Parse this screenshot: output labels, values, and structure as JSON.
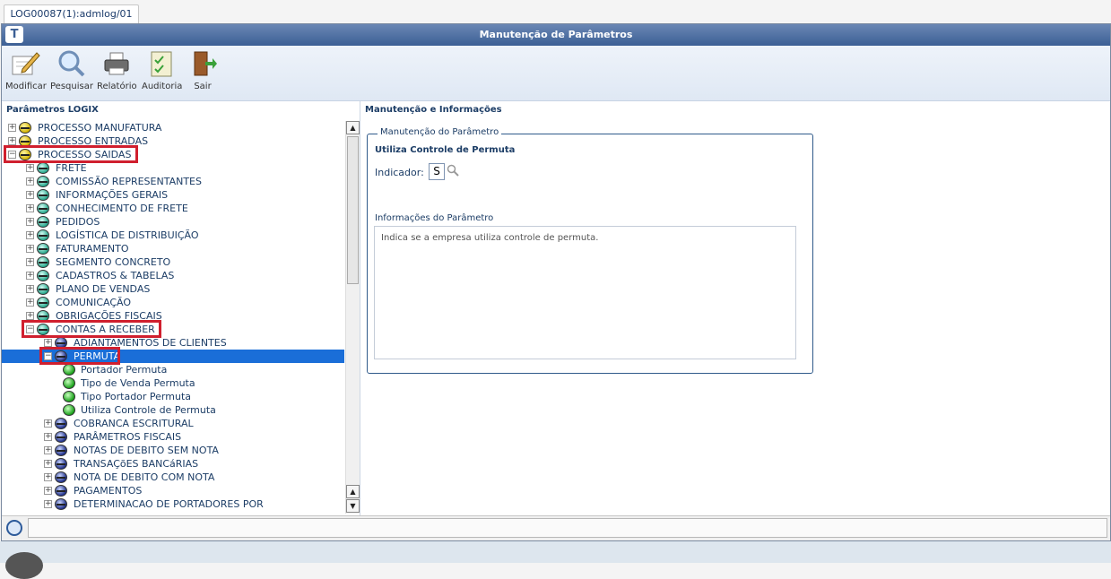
{
  "tab": {
    "label": "LOG00087(1):admlog/01"
  },
  "window": {
    "title": "Manutenção de Parâmetros"
  },
  "toolbar": {
    "modificar": "Modificar",
    "pesquisar": "Pesquisar",
    "relatorio": "Relatório",
    "auditoria": "Auditoria",
    "sair": "Sair"
  },
  "left": {
    "title": "Parâmetros LOGIX",
    "tree": [
      {
        "label": "PROCESSO MANUFATURA",
        "level": 0,
        "icon": "yellow-node-icon",
        "expander": "+"
      },
      {
        "label": "PROCESSO ENTRADAS",
        "level": 0,
        "icon": "yellow-node-icon",
        "expander": "+"
      },
      {
        "label": "PROCESSO SAIDAS",
        "level": 0,
        "icon": "yellow-node-icon",
        "expander": "-"
      },
      {
        "label": "FRETE",
        "level": 1,
        "icon": "teal-node-icon",
        "expander": "+"
      },
      {
        "label": "COMISSÃO REPRESENTANTES",
        "level": 1,
        "icon": "teal-node-icon",
        "expander": "+"
      },
      {
        "label": "INFORMAÇÕES GERAIS",
        "level": 1,
        "icon": "teal-node-icon",
        "expander": "+"
      },
      {
        "label": "CONHECIMENTO DE FRETE",
        "level": 1,
        "icon": "teal-node-icon",
        "expander": "+"
      },
      {
        "label": "PEDIDOS",
        "level": 1,
        "icon": "teal-node-icon",
        "expander": "+"
      },
      {
        "label": "LOGÍSTICA DE DISTRIBUIÇÃO",
        "level": 1,
        "icon": "teal-node-icon",
        "expander": "+"
      },
      {
        "label": "FATURAMENTO",
        "level": 1,
        "icon": "teal-node-icon",
        "expander": "+"
      },
      {
        "label": "SEGMENTO CONCRETO",
        "level": 1,
        "icon": "teal-node-icon",
        "expander": "+"
      },
      {
        "label": "CADASTROS & TABELAS",
        "level": 1,
        "icon": "teal-node-icon",
        "expander": "+"
      },
      {
        "label": "PLANO DE VENDAS",
        "level": 1,
        "icon": "teal-node-icon",
        "expander": "+"
      },
      {
        "label": "COMUNICAÇÃO",
        "level": 1,
        "icon": "teal-node-icon",
        "expander": "+"
      },
      {
        "label": "OBRIGAÇÕES FISCAIS",
        "level": 1,
        "icon": "teal-node-icon",
        "expander": "+"
      },
      {
        "label": "CONTAS A RECEBER",
        "level": 1,
        "icon": "teal-node-icon",
        "expander": "-"
      },
      {
        "label": "ADIANTAMENTOS DE CLIENTES",
        "level": 2,
        "icon": "navy-node-icon",
        "expander": "+"
      },
      {
        "label": "PERMUTA",
        "level": 2,
        "icon": "navy-node-icon",
        "expander": "-",
        "selected": true
      },
      {
        "label": "Portador Permuta",
        "level": 3,
        "icon": "green-leaf-icon",
        "expander": ""
      },
      {
        "label": "Tipo de Venda Permuta",
        "level": 3,
        "icon": "green-leaf-icon",
        "expander": ""
      },
      {
        "label": "Tipo Portador Permuta",
        "level": 3,
        "icon": "green-leaf-icon",
        "expander": ""
      },
      {
        "label": "Utiliza Controle de Permuta",
        "level": 3,
        "icon": "green-leaf-icon",
        "expander": ""
      },
      {
        "label": "COBRANCA ESCRITURAL",
        "level": 2,
        "icon": "navy-node-icon",
        "expander": "+"
      },
      {
        "label": "PARÂMETROS FISCAIS",
        "level": 2,
        "icon": "navy-node-icon",
        "expander": "+"
      },
      {
        "label": "NOTAS DE DEBITO SEM NOTA",
        "level": 2,
        "icon": "navy-node-icon",
        "expander": "+"
      },
      {
        "label": "TRANSAÇõES BANCáRIAS",
        "level": 2,
        "icon": "navy-node-icon",
        "expander": "+"
      },
      {
        "label": "NOTA DE DEBITO COM NOTA",
        "level": 2,
        "icon": "navy-node-icon",
        "expander": "+"
      },
      {
        "label": "PAGAMENTOS",
        "level": 2,
        "icon": "navy-node-icon",
        "expander": "+"
      },
      {
        "label": "DETERMINACAO DE PORTADORES POR",
        "level": 2,
        "icon": "navy-node-icon",
        "expander": "+"
      }
    ]
  },
  "right": {
    "title": "Manutenção e Informações",
    "group_legend": "Manutenção do Parâmetro",
    "param_name": "Utiliza Controle de Permuta",
    "indicador_label": "Indicador:",
    "indicador_value": "S",
    "info_label": "Informações do Parâmetro",
    "info_text": "Indica se a empresa utiliza controle de permuta."
  },
  "colors": {
    "selection": "#1a6ed8",
    "highlight": "#d01f2e",
    "titlebar": "#3c5f95"
  }
}
